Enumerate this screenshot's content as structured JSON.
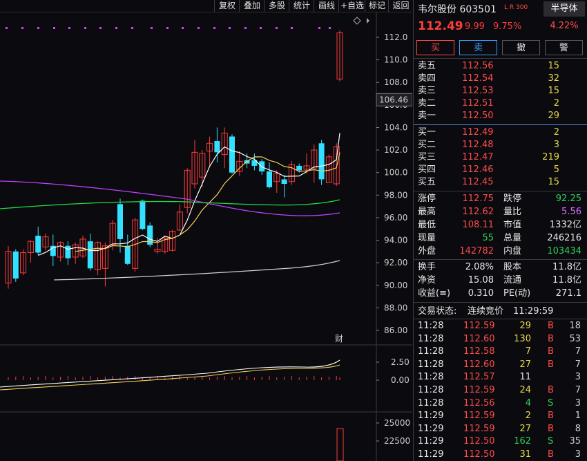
{
  "toolbar": {
    "items": [
      "复权",
      "叠加",
      "多股",
      "统计",
      "画线",
      "+自选",
      "标记",
      "返回"
    ]
  },
  "chart": {
    "price_axis": [
      "112.0",
      "110.0",
      "108.0",
      "106.0",
      "104.0",
      "102.0",
      "100.0",
      "98.00",
      "96.00",
      "94.00",
      "92.00",
      "90.00",
      "88.00",
      "86.00"
    ],
    "current_price_label": "106.46",
    "finance_marker": "财",
    "macd_axis": [
      "2.50",
      "0.00"
    ],
    "volume_axis": [
      "25000",
      "22500"
    ],
    "colors": {
      "up": "#ff3b3b",
      "down": "#33e0ff",
      "ma5": "#ffffff",
      "ma10": "#f5d05a",
      "ma20": "#c040ff",
      "ma60": "#22dd44",
      "ma120": "#cfcfcf",
      "dots": "#d040ff"
    }
  },
  "chart_data": {
    "type": "candlestick",
    "ylim": [
      84.5,
      113.5
    ],
    "candles": [
      {
        "o": 90.2,
        "h": 93.5,
        "l": 89.7,
        "c": 93.0
      },
      {
        "o": 93.0,
        "h": 93.2,
        "l": 90.3,
        "c": 90.6
      },
      {
        "o": 91.1,
        "h": 93.2,
        "l": 90.9,
        "c": 92.9
      },
      {
        "o": 92.9,
        "h": 94.0,
        "l": 92.0,
        "c": 93.9
      },
      {
        "o": 94.4,
        "h": 95.2,
        "l": 92.7,
        "c": 92.9
      },
      {
        "o": 93.4,
        "h": 94.6,
        "l": 93.1,
        "c": 94.3
      },
      {
        "o": 93.5,
        "h": 94.5,
        "l": 91.7,
        "c": 92.6
      },
      {
        "o": 92.5,
        "h": 93.9,
        "l": 92.1,
        "c": 93.8
      },
      {
        "o": 93.5,
        "h": 93.9,
        "l": 91.8,
        "c": 92.4
      },
      {
        "o": 92.5,
        "h": 93.8,
        "l": 91.9,
        "c": 93.6
      },
      {
        "o": 92.6,
        "h": 94.4,
        "l": 92.4,
        "c": 94.1
      },
      {
        "o": 93.9,
        "h": 94.6,
        "l": 91.3,
        "c": 91.5
      },
      {
        "o": 91.4,
        "h": 93.9,
        "l": 90.9,
        "c": 93.8
      },
      {
        "o": 91.5,
        "h": 93.8,
        "l": 89.9,
        "c": 93.5
      },
      {
        "o": 93.6,
        "h": 95.8,
        "l": 93.1,
        "c": 95.5
      },
      {
        "o": 97.2,
        "h": 97.7,
        "l": 92.9,
        "c": 94.1
      },
      {
        "o": 93.5,
        "h": 94.5,
        "l": 91.8,
        "c": 91.9
      },
      {
        "o": 91.5,
        "h": 96.0,
        "l": 91.2,
        "c": 95.8
      },
      {
        "o": 97.5,
        "h": 97.6,
        "l": 94.9,
        "c": 95.0
      },
      {
        "o": 95.3,
        "h": 95.6,
        "l": 93.4,
        "c": 93.6
      },
      {
        "o": 93.0,
        "h": 94.2,
        "l": 92.8,
        "c": 93.2
      },
      {
        "o": 93.0,
        "h": 94.4,
        "l": 92.8,
        "c": 94.2
      },
      {
        "o": 93.1,
        "h": 94.9,
        "l": 93.0,
        "c": 94.8
      },
      {
        "o": 94.9,
        "h": 97.2,
        "l": 94.8,
        "c": 96.5
      },
      {
        "o": 96.9,
        "h": 100.4,
        "l": 96.4,
        "c": 100.2
      },
      {
        "o": 99.0,
        "h": 102.9,
        "l": 98.6,
        "c": 101.8
      },
      {
        "o": 99.6,
        "h": 102.0,
        "l": 98.7,
        "c": 101.7
      },
      {
        "o": 101.9,
        "h": 103.2,
        "l": 100.5,
        "c": 102.6
      },
      {
        "o": 102.8,
        "h": 104.0,
        "l": 100.9,
        "c": 101.8
      },
      {
        "o": 101.6,
        "h": 104.0,
        "l": 100.4,
        "c": 103.5
      },
      {
        "o": 103.2,
        "h": 103.4,
        "l": 99.9,
        "c": 100.0
      },
      {
        "o": 100.1,
        "h": 101.9,
        "l": 99.7,
        "c": 101.0
      },
      {
        "o": 101.1,
        "h": 101.7,
        "l": 100.4,
        "c": 100.8
      },
      {
        "o": 101.1,
        "h": 101.7,
        "l": 100.2,
        "c": 100.6
      },
      {
        "o": 101.0,
        "h": 101.2,
        "l": 99.8,
        "c": 100.1
      },
      {
        "o": 100.1,
        "h": 100.9,
        "l": 98.6,
        "c": 98.7
      },
      {
        "o": 99.2,
        "h": 100.2,
        "l": 98.2,
        "c": 99.9
      },
      {
        "o": 99.4,
        "h": 99.8,
        "l": 97.8,
        "c": 99.0
      },
      {
        "o": 99.2,
        "h": 101.0,
        "l": 98.9,
        "c": 100.7
      },
      {
        "o": 100.6,
        "h": 100.8,
        "l": 100.0,
        "c": 100.2
      },
      {
        "o": 100.3,
        "h": 101.7,
        "l": 99.9,
        "c": 100.6
      },
      {
        "o": 100.4,
        "h": 102.5,
        "l": 99.1,
        "c": 102.0
      },
      {
        "o": 102.6,
        "h": 102.9,
        "l": 98.9,
        "c": 99.4
      },
      {
        "o": 99.1,
        "h": 101.6,
        "l": 99.2,
        "c": 101.4
      },
      {
        "o": 99.0,
        "h": 102.6,
        "l": 98.8,
        "c": 102.3
      },
      {
        "o": 108.3,
        "h": 112.6,
        "l": 108.1,
        "c": 112.4
      }
    ]
  },
  "quote": {
    "name": "韦尔股份",
    "code": "603501",
    "lr": "L R",
    "lr_sub": "300",
    "sector": "半导体",
    "sector_pct": "4.22%",
    "price": "112.49",
    "change": "9.99",
    "change_pct": "9.75%",
    "buttons": [
      "买",
      "卖",
      "撤",
      "警"
    ],
    "sells": [
      {
        "label": "卖五",
        "price": "112.56",
        "vol": "15"
      },
      {
        "label": "卖四",
        "price": "112.54",
        "vol": "32"
      },
      {
        "label": "卖三",
        "price": "112.53",
        "vol": "15"
      },
      {
        "label": "卖二",
        "price": "112.51",
        "vol": "2"
      },
      {
        "label": "卖一",
        "price": "112.50",
        "vol": "29"
      }
    ],
    "buys": [
      {
        "label": "买一",
        "price": "112.49",
        "vol": "2"
      },
      {
        "label": "买二",
        "price": "112.48",
        "vol": "3"
      },
      {
        "label": "买三",
        "price": "112.47",
        "vol": "219"
      },
      {
        "label": "买四",
        "price": "112.46",
        "vol": "5"
      },
      {
        "label": "买五",
        "price": "112.45",
        "vol": "15"
      }
    ],
    "stats1": [
      {
        "l1": "涨停",
        "v1": "112.75",
        "l2": "跌停",
        "v2": "92.25"
      },
      {
        "l1": "最高",
        "v1": "112.62",
        "l2": "量比",
        "v2": "5.56"
      },
      {
        "l1": "最低",
        "v1": "108.11",
        "l2": "市值",
        "v2": "1332亿"
      },
      {
        "l1": "现量",
        "v1": "55",
        "l2": "总量",
        "v2": "246216"
      },
      {
        "l1": "外盘",
        "v1": "142782",
        "l2": "内盘",
        "v2": "103434"
      }
    ],
    "stats2": [
      {
        "l1": "换手",
        "v1": "2.08%",
        "l2": "股本",
        "v2": "11.8亿"
      },
      {
        "l1": "净资",
        "v1": "15.08",
        "l2": "流通",
        "v2": "11.8亿"
      },
      {
        "l1": "收益(≡)",
        "v1": "0.310",
        "l2": "PE(动)",
        "v2": "271.1"
      }
    ],
    "status_label": "交易状态:",
    "status_value": "连续竞价",
    "status_time": "11:29:59",
    "ticks": [
      {
        "t": "11:28",
        "p": "112.59",
        "v": "29",
        "s": "B",
        "n": "18"
      },
      {
        "t": "11:28",
        "p": "112.60",
        "v": "130",
        "s": "B",
        "n": "53"
      },
      {
        "t": "11:28",
        "p": "112.58",
        "v": "7",
        "s": "B",
        "n": "7"
      },
      {
        "t": "11:28",
        "p": "112.60",
        "v": "27",
        "s": "B",
        "n": "7"
      },
      {
        "t": "11:28",
        "p": "112.57",
        "v": "11",
        "s": "",
        "n": "3"
      },
      {
        "t": "11:28",
        "p": "112.59",
        "v": "24",
        "s": "B",
        "n": "7"
      },
      {
        "t": "11:28",
        "p": "112.56",
        "v": "4",
        "s": "S",
        "n": "3"
      },
      {
        "t": "11:29",
        "p": "112.59",
        "v": "2",
        "s": "B",
        "n": "1"
      },
      {
        "t": "11:29",
        "p": "112.59",
        "v": "27",
        "s": "B",
        "n": "8"
      },
      {
        "t": "11:29",
        "p": "112.50",
        "v": "162",
        "s": "S",
        "n": "35"
      },
      {
        "t": "11:29",
        "p": "112.50",
        "v": "31",
        "s": "B",
        "n": "3"
      }
    ]
  }
}
